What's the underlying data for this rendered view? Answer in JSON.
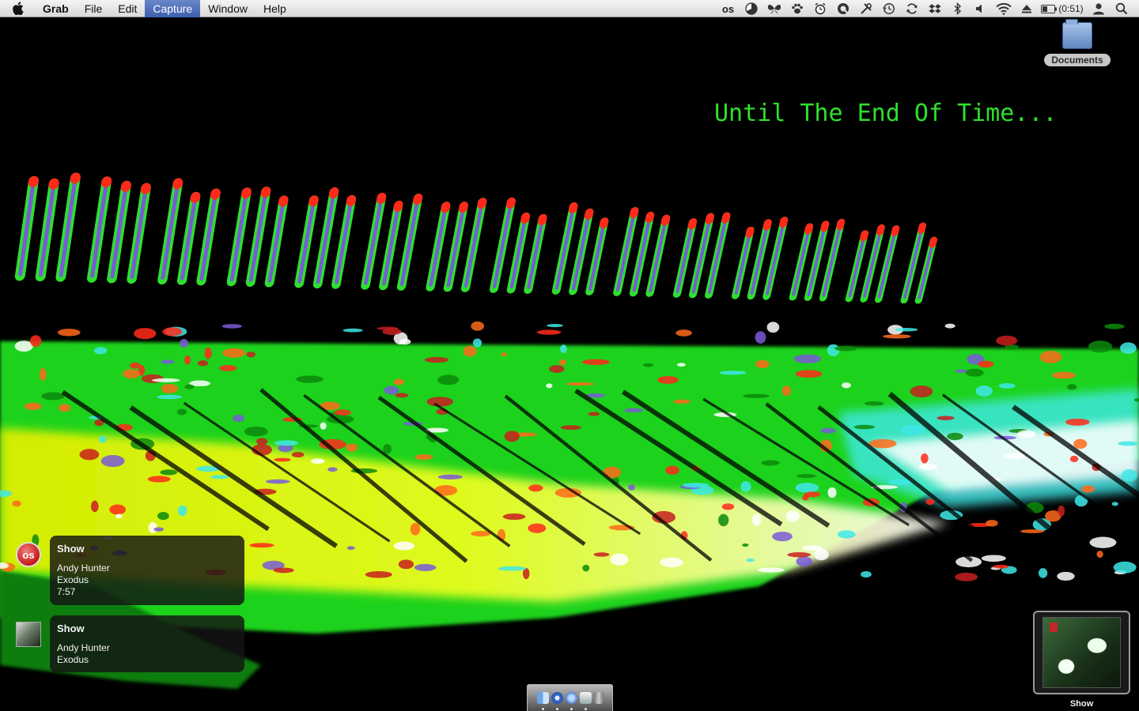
{
  "menubar": {
    "apple_icon": "apple-icon",
    "items": [
      {
        "label": "Grab",
        "role": "app"
      },
      {
        "label": "File"
      },
      {
        "label": "Edit"
      },
      {
        "label": "Capture",
        "active": true
      },
      {
        "label": "Window"
      },
      {
        "label": "Help"
      }
    ],
    "status_icons": [
      "lastfm-icon",
      "pie-clock-icon",
      "butterfly-icon",
      "paw-icon",
      "alarm-clock-icon",
      "quicksilver-icon",
      "tools-icon",
      "time-machine-icon",
      "sync-icon",
      "dropbox-icon",
      "bluetooth-icon",
      "volume-icon",
      "wifi-icon",
      "eject-icon"
    ],
    "lastfm_glyph": "os",
    "battery_time": "(0:51)"
  },
  "desktop": {
    "documents_label": "Documents",
    "tagline": "Until The End Of Time..."
  },
  "notifications": [
    {
      "title": "Show",
      "artist": "Andy Hunter",
      "album": "Exodus",
      "time": "7:57",
      "icon": "lastfm-icon"
    },
    {
      "title": "Show",
      "artist": "Andy Hunter",
      "album": "Exodus",
      "icon": "album-art-icon"
    }
  ],
  "lastfm_badge_glyph": "os",
  "dock": {
    "apps": [
      "finder-icon",
      "itunes-icon",
      "safari-icon",
      "preview-icon",
      "trash-icon"
    ]
  },
  "art_widget": {
    "label": "Show"
  },
  "colors": {
    "tagline_green": "#2fe02f",
    "menu_active": "#3c5fb0"
  }
}
